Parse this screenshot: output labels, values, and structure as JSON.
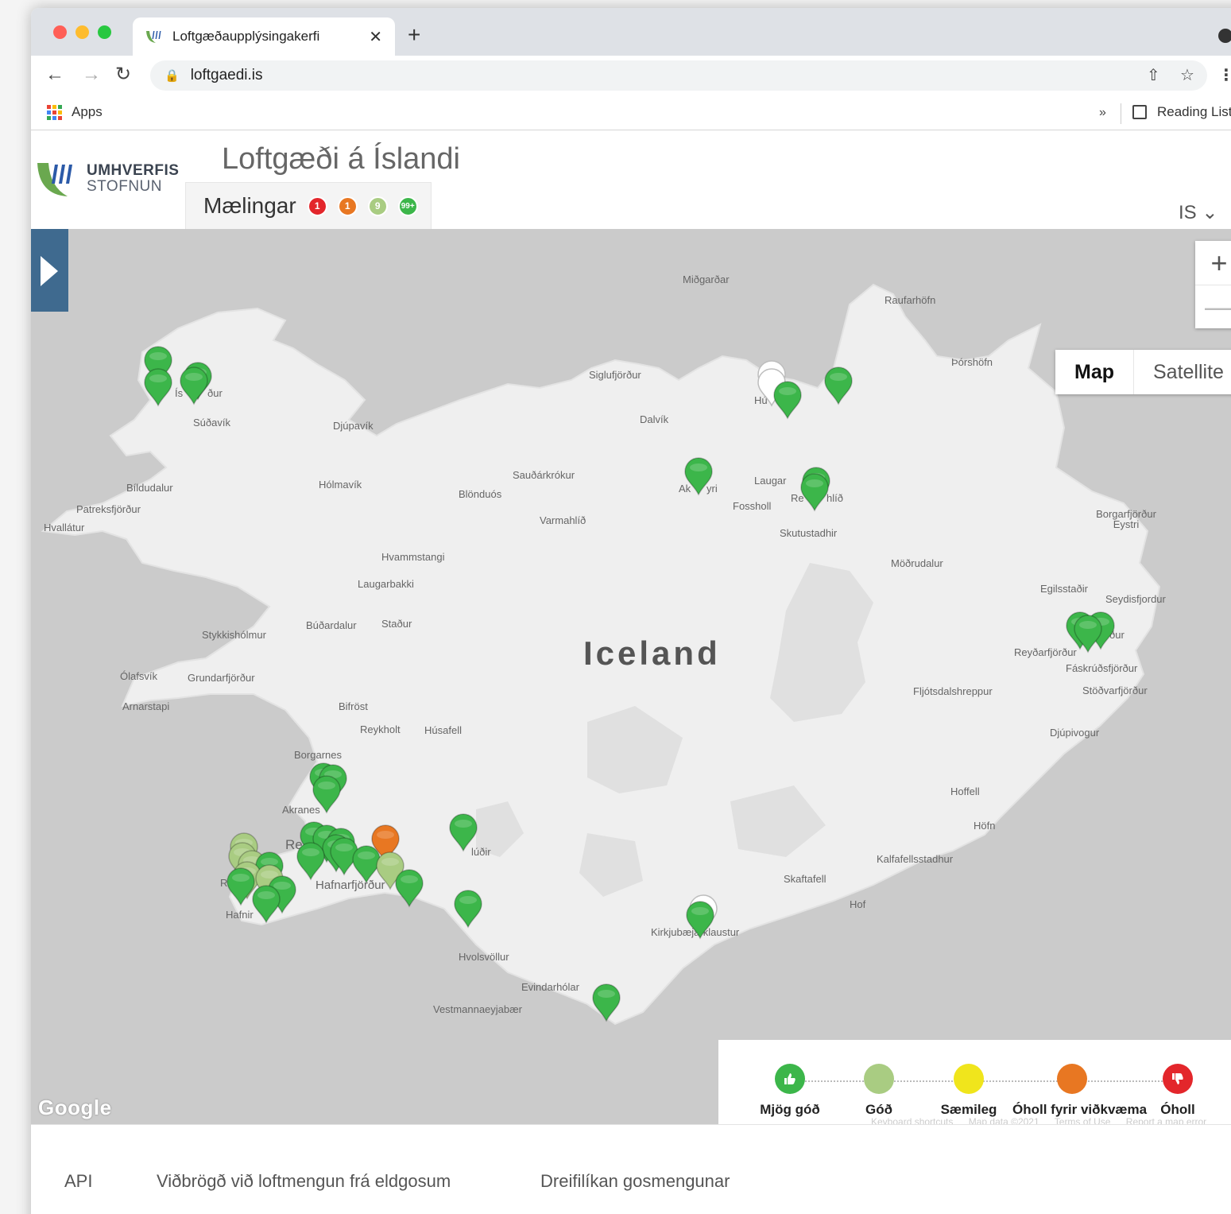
{
  "browser": {
    "tab_title": "Loftgæðaupplýsingakerfi",
    "tab_close": "✕",
    "new_tab": "+",
    "url": "loftgaedi.is",
    "bookmarks": {
      "apps_label": "Apps",
      "overflow": "»",
      "reading_list": "Reading List"
    }
  },
  "header": {
    "logo_line1": "UMHVERFIS",
    "logo_line2": "STOFNUN",
    "title": "Loftgæði á Íslandi",
    "measurements_label": "Mælingar",
    "badges": [
      {
        "value": "1",
        "color": "#e3262b"
      },
      {
        "value": "1",
        "color": "#e87722"
      },
      {
        "value": "9",
        "color": "#a9cc82"
      },
      {
        "value": "99+",
        "color": "#3cb64a"
      }
    ],
    "language": "IS ⌄"
  },
  "map": {
    "country_label": "Iceland",
    "zoom_in": "+",
    "zoom_out": "—",
    "type_map": "Map",
    "type_satellite": "Satellite",
    "google": "Google",
    "places": [
      "Miðgarðar",
      "Raufarhöfn",
      "Þórshöfn",
      "Siglufjörður",
      "Dalvík",
      "Súðavík",
      "Djúpavík",
      "Bíldudalur",
      "Patreksfjörður",
      "Hvallátur",
      "Hólmavík",
      "Sauðárkrókur",
      "Blönduós",
      "Varmahlíð",
      "Laugar",
      "Fossholl",
      "Skutustadhir",
      "Borgarfjörður Eystri",
      "Möðrudalur",
      "Hvammstangi",
      "Laugarbakki",
      "Egilsstaðir",
      "Seydisfjordur",
      "Búðardalur",
      "Staður",
      "Stykkishólmur",
      "Reyðarfjörður",
      "Fáskrúðsfjörður",
      "Ólafsvík",
      "Grundarfjörður",
      "Fljótsdalshreppur",
      "Stöðvarfjörður",
      "Arnarstapi",
      "Bifröst",
      "Reykholt",
      "Húsafell",
      "Djúpivogur",
      "Borgarnes",
      "Hoffell",
      "Akranes",
      "Höfn",
      "Kalfafellsstadhur",
      "Skaftafell",
      "Hof",
      "Hafnarfjörður",
      "Hafnir",
      "Kirkjubæjarklaustur",
      "Hvolsvöllur",
      "Evindarhólar",
      "Vestmannaeyjabær",
      "Re",
      "Ak",
      "yri",
      "Ís",
      "ður",
      "Hú",
      "Re",
      "hlíð",
      "lúðir",
      "ður",
      "R"
    ],
    "pin_colors": {
      "very_good": "#3cb64a",
      "good": "#a9cc82",
      "moderate": "#f0e51c",
      "sensitive": "#e87722",
      "unhealthy": "#e3262b",
      "offline": "#ffffff"
    },
    "legend": [
      {
        "label": "Mjög góð",
        "color": "#3cb64a",
        "icon": "thumbs-up-icon"
      },
      {
        "label": "Góð",
        "color": "#a9cc82",
        "icon": ""
      },
      {
        "label": "Sæmileg",
        "color": "#f0e51c",
        "icon": ""
      },
      {
        "label": "Óholl fyrir viðkvæma",
        "color": "#e87722",
        "icon": ""
      },
      {
        "label": "Óholl",
        "color": "#e3262b",
        "icon": "thumbs-down-icon"
      }
    ],
    "footer": [
      "Keyboard shortcuts",
      "Map data ©2021",
      "Terms of Use",
      "Report a map error"
    ]
  },
  "bottom_nav": {
    "api": "API",
    "volcano": "Viðbrögð við loftmengun frá eldgosum",
    "dispersion": "Dreifilíkan gosmengunar"
  }
}
